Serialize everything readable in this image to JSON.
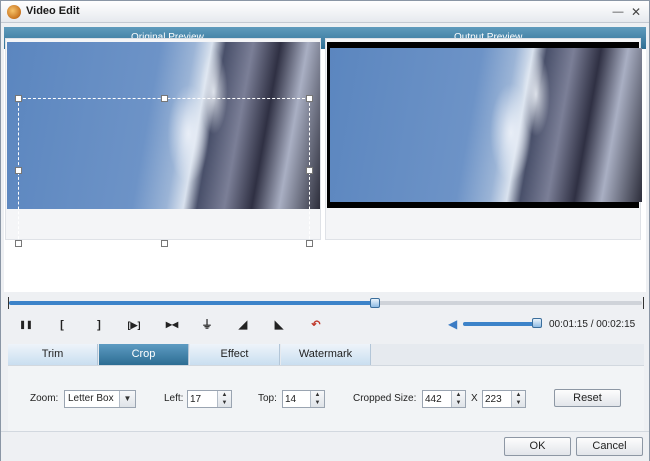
{
  "window": {
    "title": "Video Edit",
    "minimize_glyph": "—",
    "close_glyph": "✕"
  },
  "preview": {
    "original_label": "Original Preview",
    "output_label": "Output Preview"
  },
  "timeline": {
    "progress_fraction": 0.578
  },
  "controls": {
    "pause_glyph": "❚❚",
    "mark_in_glyph": "[",
    "mark_out_glyph": "]",
    "play_segment_glyph": "[▶]",
    "split_glyph": "▶◀",
    "flip_vertical_glyph": "⏚",
    "rotate_left_glyph": "◢",
    "rotate_right_glyph": "◣",
    "undo_glyph": "↶",
    "volume_glyph": "◀",
    "volume_fraction": 0.95,
    "time_readout": "00:01:15 / 00:02:15"
  },
  "tabs": [
    {
      "label": "Trim",
      "active": false
    },
    {
      "label": "Crop",
      "active": true
    },
    {
      "label": "Effect",
      "active": false
    },
    {
      "label": "Watermark",
      "active": false
    }
  ],
  "crop": {
    "zoom_label": "Zoom:",
    "zoom_value": "Letter Box",
    "left_label": "Left:",
    "left_value": "17",
    "top_label": "Top:",
    "top_value": "14",
    "cropped_size_label": "Cropped Size:",
    "width_value": "442",
    "times_label": "X",
    "height_value": "223",
    "reset_label": "Reset"
  },
  "footer": {
    "ok_label": "OK",
    "cancel_label": "Cancel"
  },
  "colors": {
    "header_bar": "#2f6f94",
    "accent_blue": "#3c83c9",
    "active_tab": "#2d6d93"
  },
  "icons": {
    "app": "app-logo-icon",
    "volume": "speaker-icon"
  }
}
